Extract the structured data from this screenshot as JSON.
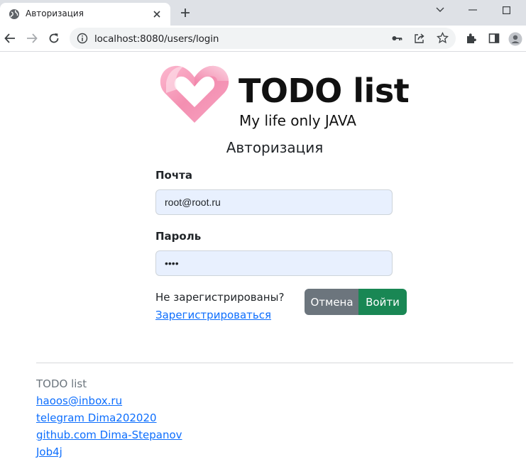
{
  "browser": {
    "tab_title": "Авторизация",
    "url": "localhost:8080/users/login"
  },
  "icons": [
    "globe-icon",
    "close-icon",
    "plus-icon",
    "chevron-down-icon",
    "minimize-icon",
    "maximize-icon",
    "back-icon",
    "forward-icon",
    "reload-icon",
    "info-icon",
    "key-icon",
    "share-icon",
    "star-icon",
    "extensions-icon",
    "sidebar-icon",
    "profile-icon",
    "heart-logo-icon"
  ],
  "colors": {
    "primary_link": "#0d6efd",
    "cancel_button": "#6c757d",
    "login_button": "#198754",
    "input_autofill_bg": "#e8f0fe"
  },
  "header": {
    "logo_title": "TODO list",
    "logo_subtitle": "My life only JAVA"
  },
  "form": {
    "heading": "Авторизация",
    "email_label": "Почта",
    "email_value": "root@root.ru",
    "password_label": "Пароль",
    "password_value": "root",
    "not_registered_text": "Не зарегистрированы?",
    "register_link": "Зарегистрироваться",
    "cancel_button": "Отмена",
    "login_button": "Войти"
  },
  "footer": {
    "title": "TODO list",
    "links": [
      "haoos@inbox.ru",
      "telegram Dima202020",
      "github.com Dima-Stepanov",
      "Job4j"
    ]
  }
}
